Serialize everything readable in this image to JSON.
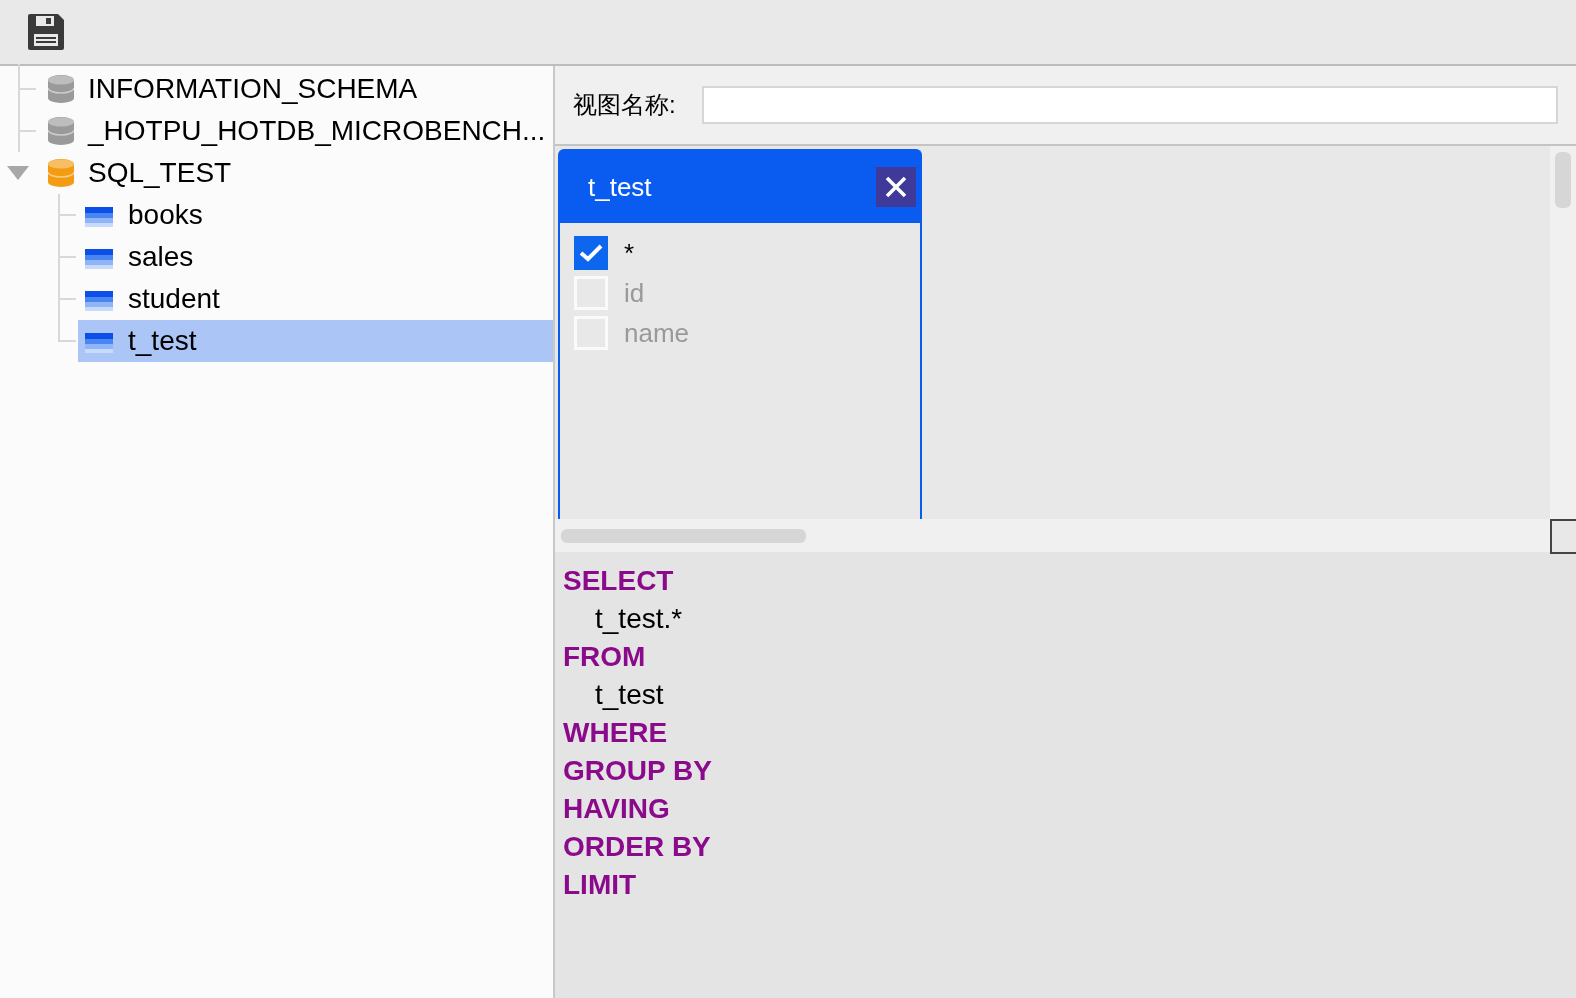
{
  "tree": [
    {
      "kind": "database",
      "label": "INFORMATION_SCHEMA",
      "color": "#9a9a9a",
      "selected": false
    },
    {
      "kind": "database",
      "label": "_HOTPU_HOTDB_MICROBENCH...",
      "color": "#9a9a9a",
      "selected": false
    },
    {
      "kind": "database",
      "label": "SQL_TEST",
      "color": "#f39c12",
      "expanded": true,
      "selected": false,
      "children": [
        {
          "kind": "table",
          "label": "books",
          "selected": false
        },
        {
          "kind": "table",
          "label": "sales",
          "selected": false
        },
        {
          "kind": "table",
          "label": "student",
          "selected": false
        },
        {
          "kind": "table",
          "label": "t_test",
          "selected": true
        }
      ]
    }
  ],
  "view_name": {
    "label": "视图名称:"
  },
  "table_card": {
    "title": "t_test",
    "columns": [
      {
        "label": "*",
        "checked": true
      },
      {
        "label": "id",
        "checked": false
      },
      {
        "label": "name",
        "checked": false
      }
    ]
  },
  "sql": [
    {
      "kind": "keyword",
      "text": "SELECT"
    },
    {
      "kind": "identifier",
      "text": "t_test.*"
    },
    {
      "kind": "keyword",
      "text": "FROM"
    },
    {
      "kind": "identifier",
      "text": "t_test"
    },
    {
      "kind": "keyword",
      "text": "WHERE"
    },
    {
      "kind": "keyword",
      "text": "GROUP BY"
    },
    {
      "kind": "keyword",
      "text": "HAVING"
    },
    {
      "kind": "keyword",
      "text": "ORDER BY"
    },
    {
      "kind": "keyword",
      "text": "LIMIT"
    }
  ]
}
